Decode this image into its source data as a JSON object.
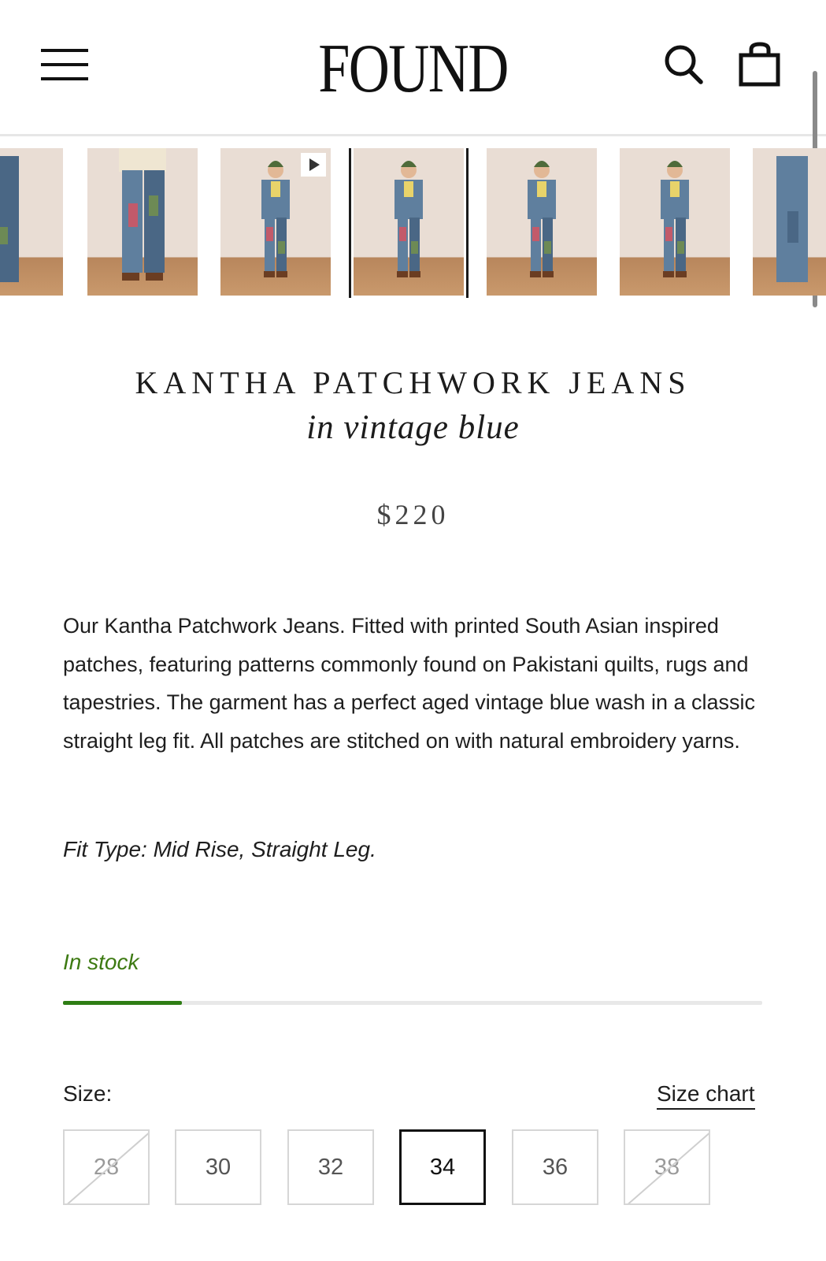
{
  "header": {
    "logo": "FOUND",
    "menu_icon": "hamburger-menu-icon",
    "search_icon": "search-icon",
    "cart_icon": "shopping-bag-icon"
  },
  "gallery": {
    "thumbnails": [
      {
        "desc": "jeans-legs-crop"
      },
      {
        "desc": "jeans-front-lower"
      },
      {
        "desc": "model-video",
        "is_video": true
      },
      {
        "desc": "model-front-full",
        "selected": true
      },
      {
        "desc": "model-walking-side"
      },
      {
        "desc": "model-standing-front"
      },
      {
        "desc": "jeans-side-crop"
      }
    ]
  },
  "product": {
    "title": "KANTHA PATCHWORK JEANS",
    "subtitle": "in vintage blue",
    "price": "$220",
    "description": "Our Kantha Patchwork Jeans. Fitted with printed South Asian inspired patches, featuring patterns commonly found on Pakistani quilts, rugs and tapestries. The garment has a perfect aged vintage blue wash in a classic straight leg fit. All patches are stitched on with natural embroidery yarns.",
    "fit": "Fit Type: Mid Rise, Straight Leg."
  },
  "stock": {
    "label": "In stock",
    "level_fraction": 0.17,
    "color": "#2e7d14"
  },
  "size": {
    "label": "Size:",
    "chart_link": "Size chart",
    "options": [
      {
        "label": "28",
        "available": false,
        "selected": false
      },
      {
        "label": "30",
        "available": true,
        "selected": false
      },
      {
        "label": "32",
        "available": true,
        "selected": false
      },
      {
        "label": "34",
        "available": true,
        "selected": true
      },
      {
        "label": "36",
        "available": true,
        "selected": false
      },
      {
        "label": "38",
        "available": false,
        "selected": false
      }
    ]
  }
}
